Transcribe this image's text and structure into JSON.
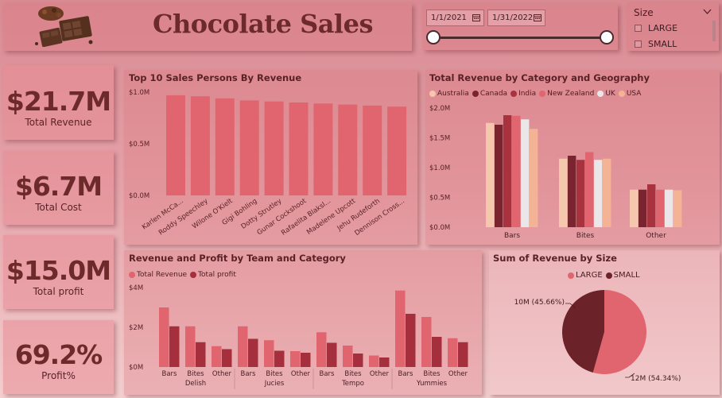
{
  "header": {
    "title": "Chocolate Sales",
    "logo_icon": "chocolate-bars-icon"
  },
  "date_filter": {
    "start": "1/1/2021",
    "end": "1/31/2022",
    "icon": "calendar-icon"
  },
  "size_filter": {
    "label": "Size",
    "options": [
      "LARGE",
      "SMALL"
    ],
    "icon": "chevron-down-icon"
  },
  "kpis": [
    {
      "value": "$21.7M",
      "label": "Total Revenue"
    },
    {
      "value": "$6.7M",
      "label": "Total Cost"
    },
    {
      "value": "$15.0M",
      "label": "Total profit"
    },
    {
      "value": "69.2%",
      "label": "Profit%"
    }
  ],
  "colors": {
    "bar_primary": "#e0656f",
    "bar_dark": "#a62f3d",
    "pie_large": "#e0656f",
    "pie_small": "#6b2228"
  },
  "chart_data": [
    {
      "type": "bar",
      "title": "Top 10 Sales Persons By Revenue",
      "categories": [
        "Karlen McCa...",
        "Roddy Speechley",
        "Wilone O'Kielt",
        "Gigi Bohling",
        "Dotty Strutley",
        "Gunar Cockshoot",
        "Rafaelita Blaksl...",
        "Madelene Upcott",
        "Jehu Rudeforth",
        "Dennison Cross..."
      ],
      "values": [
        0.97,
        0.96,
        0.94,
        0.92,
        0.91,
        0.9,
        0.89,
        0.88,
        0.87,
        0.86
      ],
      "y_ticks": [
        "$0.0M",
        "$0.5M",
        "$1.0M"
      ],
      "ylim": [
        0,
        1.0
      ],
      "grid": false
    },
    {
      "type": "bar",
      "title": "Total Revenue by Category and Geography",
      "categories": [
        "Bars",
        "Bites",
        "Other"
      ],
      "series": [
        {
          "name": "Australia",
          "color": "#f5c8ae",
          "values": [
            1.75,
            1.15,
            0.63
          ]
        },
        {
          "name": "Canada",
          "color": "#7a2430",
          "values": [
            1.72,
            1.2,
            0.63
          ]
        },
        {
          "name": "India",
          "color": "#a8323e",
          "values": [
            1.88,
            1.13,
            0.72
          ]
        },
        {
          "name": "New Zealand",
          "color": "#e0656f",
          "values": [
            1.87,
            1.26,
            0.63
          ]
        },
        {
          "name": "UK",
          "color": "#ebe6e7",
          "values": [
            1.81,
            1.13,
            0.63
          ]
        },
        {
          "name": "USA",
          "color": "#f4b395",
          "values": [
            1.65,
            1.15,
            0.62
          ]
        }
      ],
      "y_ticks": [
        "$0.0M",
        "$0.5M",
        "$1.0M",
        "$1.5M",
        "$2.0M"
      ],
      "ylim": [
        0,
        2.0
      ],
      "legend_position": "top-left",
      "grid": false
    },
    {
      "type": "bar",
      "title": "Revenue and Profit by Team and Category",
      "groups": [
        "Delish",
        "Jucies",
        "Tempo",
        "Yummies"
      ],
      "categories": [
        "Bars",
        "Bites",
        "Other"
      ],
      "series": [
        {
          "name": "Total Revenue",
          "color": "#e0656f",
          "values": [
            3.0,
            2.05,
            1.05,
            2.05,
            1.35,
            0.8,
            1.75,
            1.08,
            0.58,
            3.85,
            2.52,
            1.45
          ]
        },
        {
          "name": "Total profit",
          "color": "#a62f3d",
          "values": [
            2.05,
            1.25,
            0.9,
            1.42,
            0.82,
            0.72,
            1.22,
            0.68,
            0.48,
            2.68,
            1.52,
            1.25
          ]
        }
      ],
      "y_ticks": [
        "$0M",
        "$2M",
        "$4M"
      ],
      "ylim": [
        0,
        4
      ],
      "legend_position": "top-left",
      "grid": false
    },
    {
      "type": "pie",
      "title": "Sum of Revenue by Size",
      "slices": [
        {
          "name": "LARGE",
          "value": 54.34,
          "label": "12M (54.34%)"
        },
        {
          "name": "SMALL",
          "value": 45.66,
          "label": "10M (45.66%)"
        }
      ],
      "legend_position": "top"
    }
  ]
}
